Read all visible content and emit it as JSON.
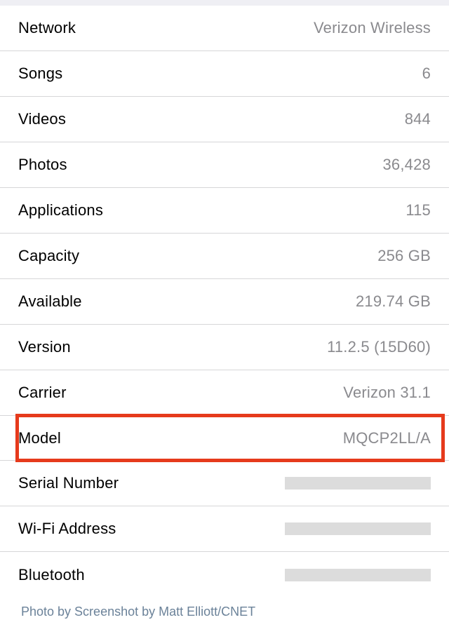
{
  "settings": {
    "rows": [
      {
        "label": "Network",
        "value": "Verizon Wireless"
      },
      {
        "label": "Songs",
        "value": "6"
      },
      {
        "label": "Videos",
        "value": "844"
      },
      {
        "label": "Photos",
        "value": "36,428"
      },
      {
        "label": "Applications",
        "value": "115"
      },
      {
        "label": "Capacity",
        "value": "256 GB"
      },
      {
        "label": "Available",
        "value": "219.74 GB"
      },
      {
        "label": "Version",
        "value": "11.2.5 (15D60)"
      },
      {
        "label": "Carrier",
        "value": "Verizon 31.1"
      },
      {
        "label": "Model",
        "value": "MQCP2LL/A"
      },
      {
        "label": "Serial Number",
        "value": ""
      },
      {
        "label": "Wi-Fi Address",
        "value": ""
      },
      {
        "label": "Bluetooth",
        "value": ""
      }
    ]
  },
  "caption": "Photo by Screenshot by Matt Elliott/CNET"
}
